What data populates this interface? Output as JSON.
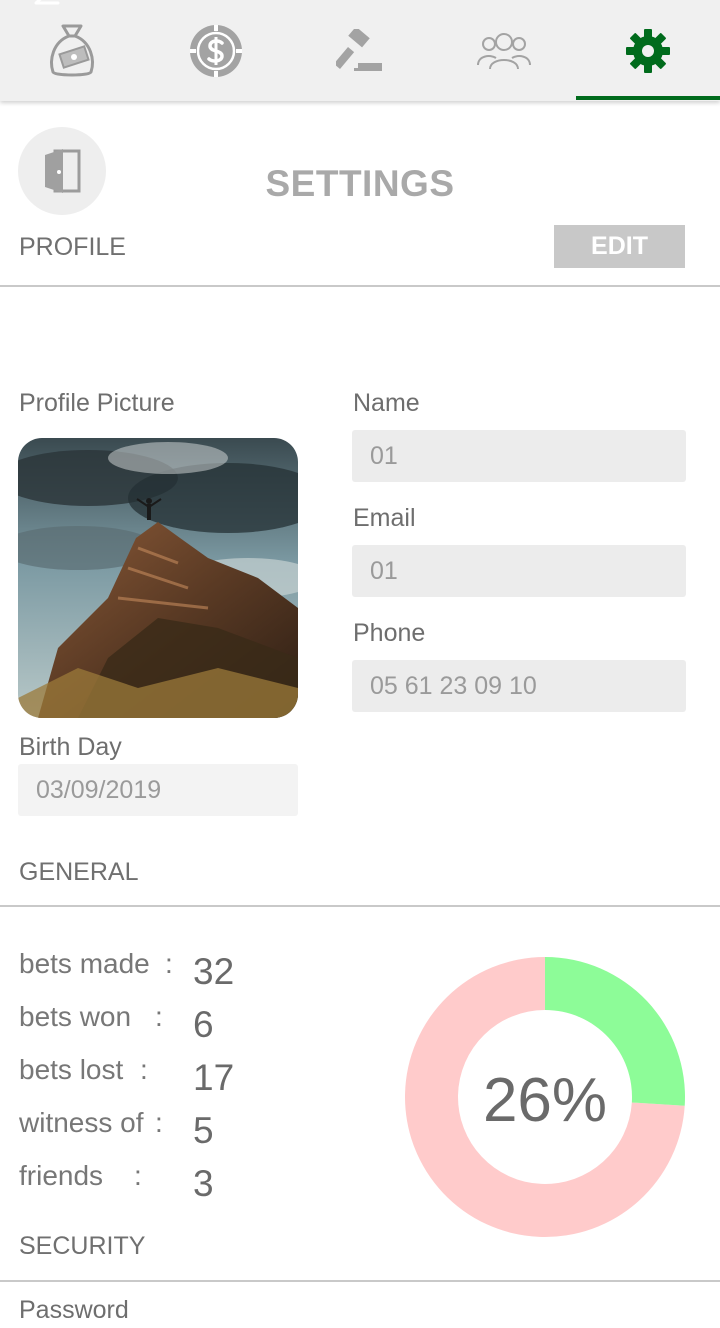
{
  "tabs": [
    {
      "icon": "money-bag-icon",
      "active": false
    },
    {
      "icon": "dollar-coin-icon",
      "active": false
    },
    {
      "icon": "gavel-icon",
      "active": false
    },
    {
      "icon": "group-icon",
      "active": false
    },
    {
      "icon": "gear-icon",
      "active": true
    }
  ],
  "header": {
    "title": "SETTINGS",
    "logout_icon": "door-icon"
  },
  "profile": {
    "section_label": "PROFILE",
    "edit_label": "EDIT",
    "picture_label": "Profile Picture",
    "name_label": "Name",
    "name_value": "01",
    "email_label": "Email",
    "email_value": "01",
    "phone_label": "Phone",
    "phone_value": "05 61 23 09 10",
    "birthday_label": "Birth Day",
    "birthday_value": "03/09/2019"
  },
  "general": {
    "section_label": "GENERAL",
    "stats": [
      {
        "label": "bets made",
        "colon": ":",
        "value": "32"
      },
      {
        "label": "bets won",
        "colon": ":",
        "value": "6"
      },
      {
        "label": "bets lost",
        "colon": ":",
        "value": "17"
      },
      {
        "label": "witness of",
        "colon": ":",
        "value": "5"
      },
      {
        "label": "friends",
        "colon": ":",
        "value": "3"
      }
    ],
    "win_rate_text": "26%",
    "win_rate": 0.26,
    "colors": {
      "won": "#8dfc98",
      "rest": "#ffcbcb",
      "accent": "#006b1c"
    }
  },
  "security": {
    "section_label": "SECURITY",
    "password_label": "Password"
  }
}
